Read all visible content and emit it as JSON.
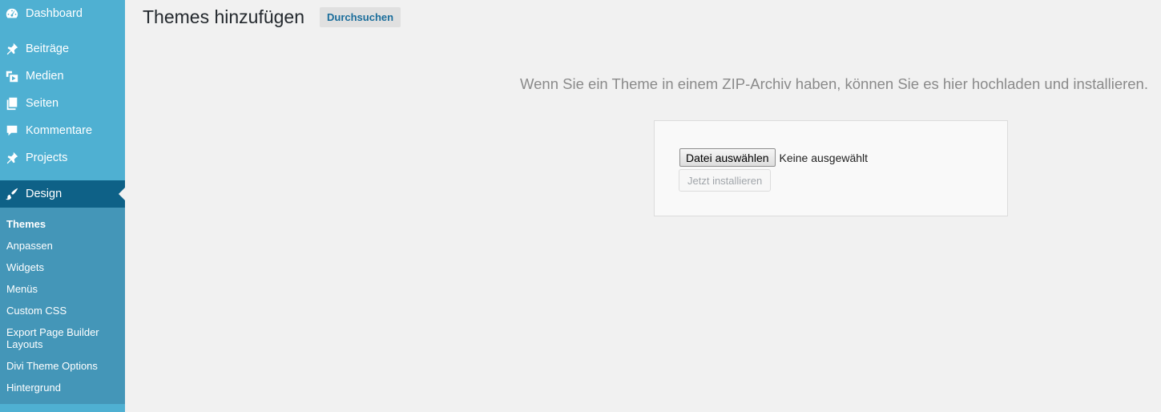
{
  "sidebar": {
    "items": [
      {
        "label": "Dashboard",
        "icon": "dashboard-icon"
      },
      {
        "label": "Beiträge",
        "icon": "pin-icon"
      },
      {
        "label": "Medien",
        "icon": "media-icon"
      },
      {
        "label": "Seiten",
        "icon": "pages-icon"
      },
      {
        "label": "Kommentare",
        "icon": "comment-icon"
      },
      {
        "label": "Projects",
        "icon": "pin-icon"
      },
      {
        "label": "Design",
        "icon": "brush-icon"
      }
    ],
    "submenu": [
      "Themes",
      "Anpassen",
      "Widgets",
      "Menüs",
      "Custom CSS",
      "Export Page Builder Layouts",
      "Divi Theme Options",
      "Hintergrund"
    ],
    "colors": {
      "background": "#4fb0d2",
      "active": "#0e6187",
      "submenu": "#4496b8"
    }
  },
  "main": {
    "title": "Themes hinzufügen",
    "browse_label": "Durchsuchen",
    "upload_description": "Wenn Sie ein Theme in einem ZIP-Archiv haben, können Sie es hier hochladen und installieren.",
    "choose_file_label": "Datei auswählen",
    "no_file_text": "Keine ausgewählt",
    "install_label": "Jetzt installieren"
  }
}
